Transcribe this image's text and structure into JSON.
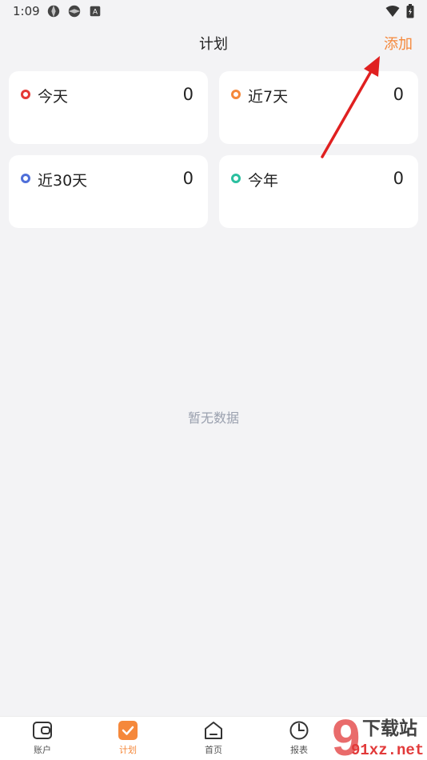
{
  "status_bar": {
    "time": "1:09",
    "icons": [
      "aperture-icon",
      "aperture-icon",
      "a-badge-icon"
    ],
    "right_icons": [
      "wifi-icon",
      "battery-icon"
    ]
  },
  "header": {
    "title": "计划",
    "add_label": "添加",
    "accent_color": "#f5883b"
  },
  "cards": [
    {
      "label": "今天",
      "value": "0",
      "dot_color": "#e53935"
    },
    {
      "label": "近7天",
      "value": "0",
      "dot_color": "#f5883b"
    },
    {
      "label": "近30天",
      "value": "0",
      "dot_color": "#4f6fd9"
    },
    {
      "label": "今年",
      "value": "0",
      "dot_color": "#2bbf9f"
    }
  ],
  "empty_state": {
    "text": "暂无数据"
  },
  "tabbar": {
    "tabs": [
      {
        "label": "账户",
        "icon": "wallet-icon",
        "active": false
      },
      {
        "label": "计划",
        "icon": "check-square-icon",
        "active": true
      },
      {
        "label": "首页",
        "icon": "home-icon",
        "active": false
      },
      {
        "label": "报表",
        "icon": "chart-icon",
        "active": false
      }
    ]
  },
  "watermark": {
    "brand": "下载站",
    "site": "91xz.net",
    "logo_digit": "9"
  },
  "annotation": {
    "arrow_color": "#e02020"
  }
}
